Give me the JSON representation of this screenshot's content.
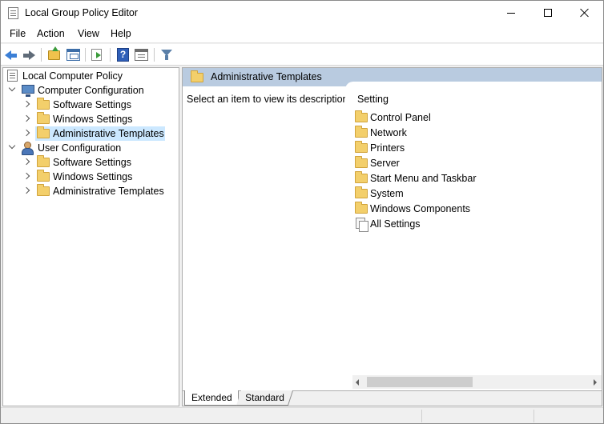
{
  "window": {
    "title": "Local Group Policy Editor"
  },
  "menu": {
    "items": [
      {
        "label": "File"
      },
      {
        "label": "Action"
      },
      {
        "label": "View"
      },
      {
        "label": "Help"
      }
    ]
  },
  "toolbar": {
    "icons": [
      "back-arrow-icon",
      "forward-arrow-icon",
      "up-folder-icon",
      "show-hide-tree-icon",
      "export-list-icon",
      "help-icon",
      "properties-icon",
      "filter-icon"
    ]
  },
  "tree": {
    "root": "Local Computer Policy",
    "computer_config": "Computer Configuration",
    "computer_children": [
      "Software Settings",
      "Windows Settings",
      "Administrative Templates"
    ],
    "user_config": "User Configuration",
    "user_children": [
      "Software Settings",
      "Windows Settings",
      "Administrative Templates"
    ],
    "selected": "Administrative Templates"
  },
  "details": {
    "header": "Administrative Templates",
    "description": "Select an item to view its description.",
    "column_header": "Setting",
    "items": [
      {
        "label": "Control Panel",
        "icon": "folder-icon"
      },
      {
        "label": "Network",
        "icon": "folder-icon"
      },
      {
        "label": "Printers",
        "icon": "folder-icon"
      },
      {
        "label": "Server",
        "icon": "folder-icon"
      },
      {
        "label": "Start Menu and Taskbar",
        "icon": "folder-icon"
      },
      {
        "label": "System",
        "icon": "folder-icon"
      },
      {
        "label": "Windows Components",
        "icon": "folder-icon"
      },
      {
        "label": "All Settings",
        "icon": "all-settings-icon"
      }
    ]
  },
  "tabs": {
    "extended": "Extended",
    "standard": "Standard",
    "active": "Extended"
  },
  "colors": {
    "header_strip": "#b9cbe0",
    "selection": "#cce8ff",
    "folder": "#f3cf6b"
  }
}
